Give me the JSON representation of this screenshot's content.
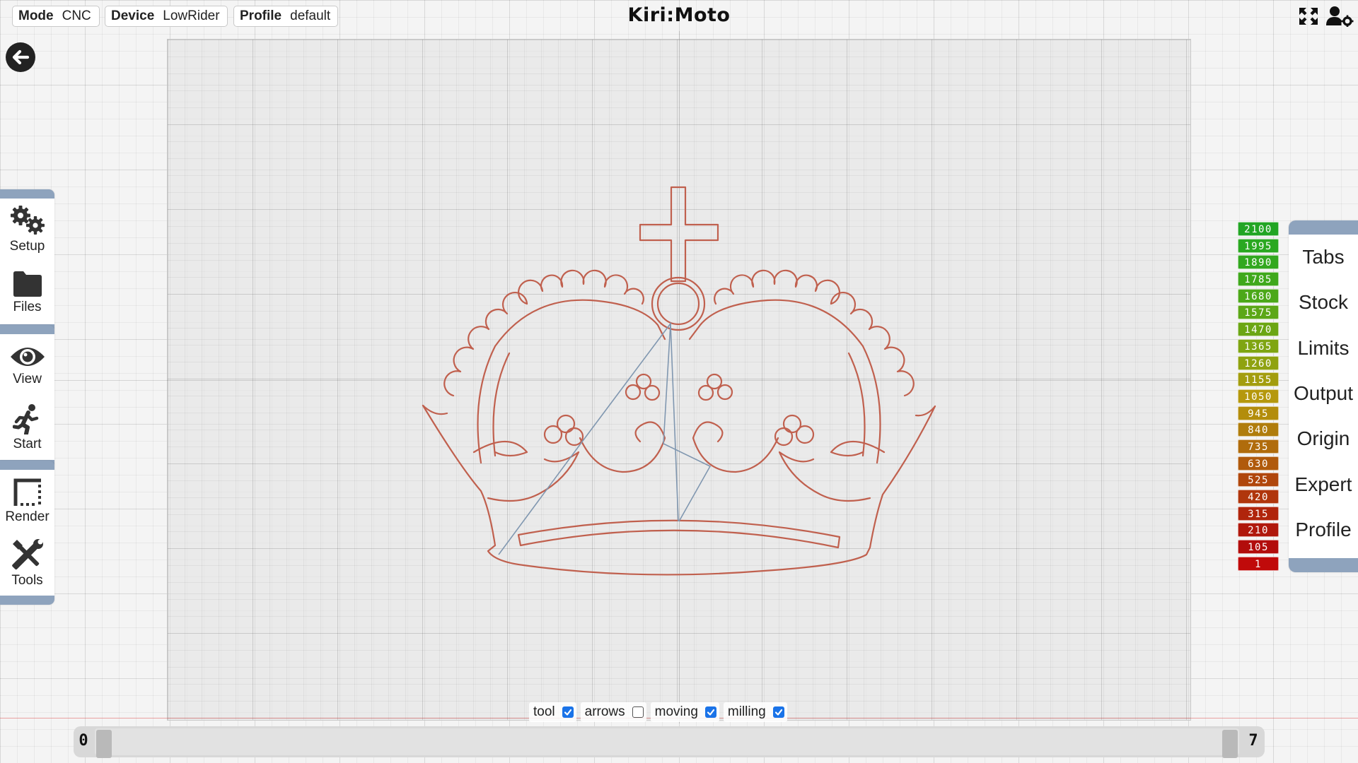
{
  "header": {
    "app_title": "Kiri:Moto",
    "mode": {
      "label": "Mode",
      "value": "CNC"
    },
    "device": {
      "label": "Device",
      "value": "LowRider"
    },
    "profile": {
      "label": "Profile",
      "value": "default"
    },
    "icons": [
      "fullscreen-icon",
      "user-settings-icon"
    ]
  },
  "left_menu": {
    "groups": [
      [
        {
          "label": "Setup",
          "icon": "gears-icon"
        },
        {
          "label": "Files",
          "icon": "folder-icon"
        }
      ],
      [
        {
          "label": "View",
          "icon": "eye-icon"
        },
        {
          "label": "Start",
          "icon": "running-person-icon"
        }
      ],
      [
        {
          "label": "Render",
          "icon": "render-icon"
        },
        {
          "label": "Tools",
          "icon": "tools-icon"
        }
      ]
    ]
  },
  "right_menu": {
    "items": [
      "Tabs",
      "Stock",
      "Limits",
      "Output",
      "Origin",
      "Expert",
      "Profile"
    ]
  },
  "layer_legend": {
    "values": [
      "2100",
      "1995",
      "1890",
      "1785",
      "1680",
      "1575",
      "1470",
      "1365",
      "1260",
      "1155",
      "1050",
      "945",
      "840",
      "735",
      "630",
      "525",
      "420",
      "315",
      "210",
      "105",
      "1"
    ],
    "colors": [
      "#22a524",
      "#2aa821",
      "#32a81f",
      "#3fa81c",
      "#4ca819",
      "#5ca717",
      "#6ba614",
      "#7fa512",
      "#8fa210",
      "#a39d0e",
      "#b5980d",
      "#b38d0c",
      "#b07d0c",
      "#b06c0c",
      "#b05a0c",
      "#b0470c",
      "#b0360c",
      "#b0250c",
      "#b0180c",
      "#b20d0c",
      "#c00a0a"
    ]
  },
  "view_toggles": [
    {
      "label": "tool",
      "checked": true
    },
    {
      "label": "arrows",
      "checked": false
    },
    {
      "label": "moving",
      "checked": true
    },
    {
      "label": "milling",
      "checked": true
    }
  ],
  "layer_slider": {
    "min_label": "0",
    "max_label": "7",
    "position": 0
  },
  "colors": {
    "path": "#c0604e",
    "move": "#8097b0",
    "accent": "#8ea3bd"
  }
}
